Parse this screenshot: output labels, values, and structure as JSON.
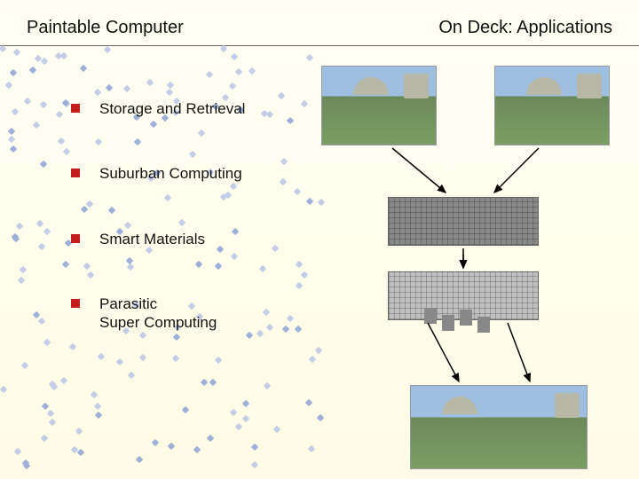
{
  "header": {
    "title_left": "Paintable Computer",
    "title_right": "On Deck:  Applications"
  },
  "bullets": [
    {
      "label": "Storage and Retrieval"
    },
    {
      "label": "Suburban Computing"
    },
    {
      "label": "Smart Materials"
    },
    {
      "label": "Parasitic\nSuper Computing"
    }
  ]
}
